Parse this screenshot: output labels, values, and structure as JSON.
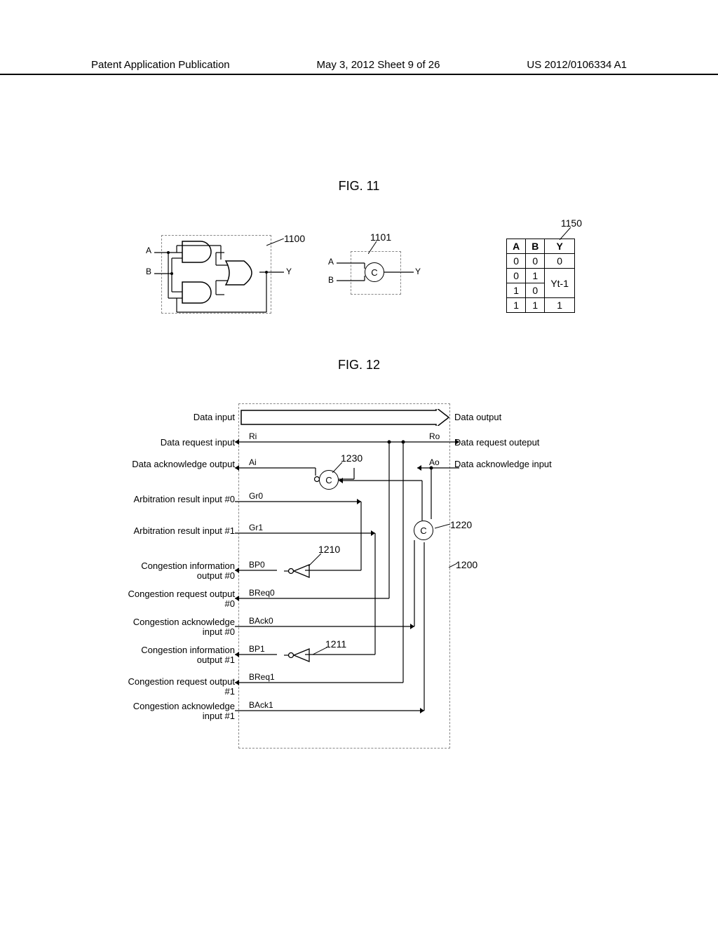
{
  "header": {
    "left": "Patent Application Publication",
    "center": "May 3, 2012  Sheet 9 of 26",
    "right": "US 2012/0106334 A1"
  },
  "fig11": {
    "label": "FIG. 11",
    "inputs": {
      "a": "A",
      "b": "B"
    },
    "output": "Y",
    "c_label": "C",
    "ref_1100": "1100",
    "ref_1101": "1101",
    "ref_1150": "1150",
    "truth_table": {
      "headers": [
        "A",
        "B",
        "Y"
      ],
      "rows": [
        [
          "0",
          "0",
          "0"
        ],
        [
          "0",
          "1",
          "Yt-1"
        ],
        [
          "1",
          "0",
          ""
        ],
        [
          "1",
          "1",
          "1"
        ]
      ]
    }
  },
  "fig12": {
    "label": "FIG. 12",
    "left_labels": {
      "data_input": "Data input",
      "data_request_input": "Data request input",
      "data_ack_output": "Data acknowledge output",
      "arb_result_0": "Arbitration result input #0",
      "arb_result_1": "Arbitration result input #1",
      "cong_info_0": "Congestion information output #0",
      "cong_req_0": "Congestion request output #0",
      "cong_ack_0": "Congestion acknowledge input #0",
      "cong_info_1": "Congestion information output #1",
      "cong_req_1": "Congestion request output #1",
      "cong_ack_1": "Congestion acknowledge input #1"
    },
    "right_labels": {
      "data_output": "Data output",
      "data_request_output": "Data request outeput",
      "data_ack_input": "Data acknowledge input"
    },
    "signals": {
      "ri": "Ri",
      "ro": "Ro",
      "ai": "Ai",
      "ao": "Ao",
      "gr0": "Gr0",
      "gr1": "Gr1",
      "bp0": "BP0",
      "bp1": "BP1",
      "breq0": "BReq0",
      "breq1": "BReq1",
      "back0": "BAck0",
      "back1": "BAck1"
    },
    "c_label": "C",
    "ref_1200": "1200",
    "ref_1210": "1210",
    "ref_1211": "1211",
    "ref_1220": "1220",
    "ref_1230": "1230"
  }
}
